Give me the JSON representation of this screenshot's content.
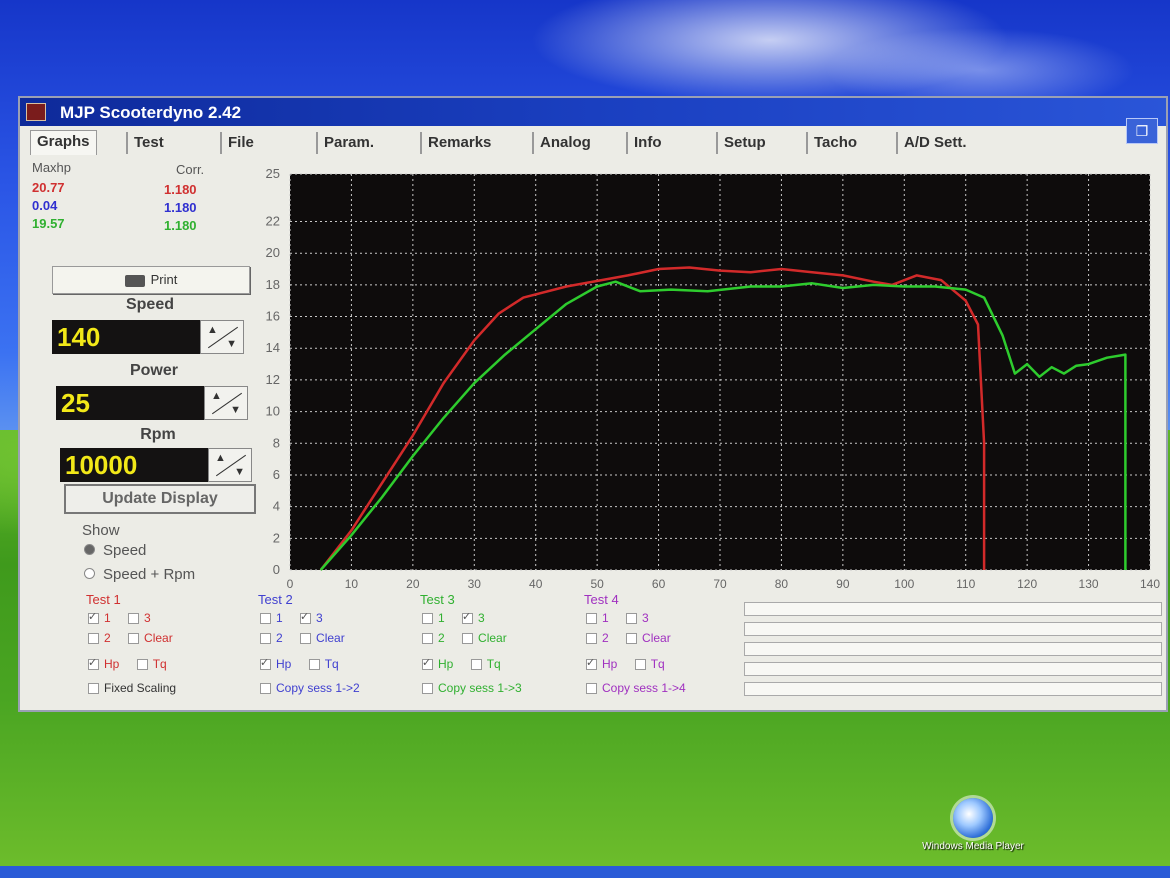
{
  "window": {
    "title": "MJP Scooterdyno 2.42",
    "restore_glyph": "❐"
  },
  "tabs": [
    "Graphs",
    "Test",
    "File",
    "Param.",
    "Remarks",
    "Analog",
    "Info",
    "Setup",
    "Tacho",
    "A/D Sett."
  ],
  "legend": {
    "col1_header": "Maxhp",
    "col2_header": "Corr.",
    "rows": [
      {
        "maxhp": "20.77",
        "corr": "1.180",
        "color": "#d03030"
      },
      {
        "maxhp": "0.04",
        "corr": "1.180",
        "color": "#3030d0"
      },
      {
        "maxhp": "19.57",
        "corr": "1.180",
        "color": "#30b030"
      }
    ]
  },
  "print_button": "Print",
  "speed": {
    "label": "Speed",
    "value": "140"
  },
  "power": {
    "label": "Power",
    "value": "25"
  },
  "rpm": {
    "label": "Rpm",
    "value": "10000"
  },
  "update_button": "Update Display",
  "show": {
    "title": "Show",
    "options": [
      "Speed",
      "Speed + Rpm"
    ],
    "selected": "Speed"
  },
  "tests": [
    {
      "title": "Test 1",
      "color": "#d03030",
      "opt1": "1",
      "opt2": "2",
      "opt3": "3",
      "clear": "Clear",
      "hp": "Hp",
      "tq": "Tq",
      "footer": "Fixed Scaling"
    },
    {
      "title": "Test 2",
      "color": "#4040d0",
      "opt1": "1",
      "opt2": "2",
      "opt3": "3",
      "clear": "Clear",
      "hp": "Hp",
      "tq": "Tq",
      "footer": "Copy sess 1->2"
    },
    {
      "title": "Test 3",
      "color": "#30b030",
      "opt1": "1",
      "opt2": "2",
      "opt3": "3",
      "clear": "Clear",
      "hp": "Hp",
      "tq": "Tq",
      "footer": "Copy sess 1->3"
    },
    {
      "title": "Test 4",
      "color": "#a030c0",
      "opt1": "1",
      "opt2": "2",
      "opt3": "3",
      "clear": "Clear",
      "hp": "Hp",
      "tq": "Tq",
      "footer": "Copy sess 1->4"
    }
  ],
  "desktop_icon": {
    "label": "Windows Media Player",
    "name": "windows-media-player-icon"
  },
  "chart_data": {
    "type": "line",
    "background": "#0e0c0c",
    "grid": true,
    "xlim": [
      0,
      140
    ],
    "ylim": [
      0,
      25
    ],
    "x_ticks": [
      0,
      10,
      20,
      30,
      40,
      50,
      60,
      70,
      80,
      90,
      100,
      110,
      120,
      130,
      140
    ],
    "y_ticks": [
      0,
      2,
      4,
      6,
      8,
      10,
      12,
      14,
      16,
      18,
      20,
      22,
      25
    ],
    "series": [
      {
        "color": "#d22a2a",
        "points": [
          [
            5,
            0
          ],
          [
            10,
            2.5
          ],
          [
            15,
            5.5
          ],
          [
            20,
            8.5
          ],
          [
            25,
            11.8
          ],
          [
            30,
            14.5
          ],
          [
            34,
            16.2
          ],
          [
            38,
            17.2
          ],
          [
            45,
            17.9
          ],
          [
            55,
            18.6
          ],
          [
            60,
            19.0
          ],
          [
            65,
            19.1
          ],
          [
            70,
            18.9
          ],
          [
            75,
            18.8
          ],
          [
            80,
            19.0
          ],
          [
            85,
            18.8
          ],
          [
            90,
            18.6
          ],
          [
            95,
            18.2
          ],
          [
            98,
            18.0
          ],
          [
            102,
            18.6
          ],
          [
            106,
            18.3
          ],
          [
            110,
            17.0
          ],
          [
            112,
            15.5
          ],
          [
            113,
            8.0
          ],
          [
            113,
            0
          ]
        ]
      },
      {
        "color": "#2ecc2e",
        "points": [
          [
            5,
            0
          ],
          [
            10,
            2.2
          ],
          [
            15,
            4.6
          ],
          [
            20,
            7.2
          ],
          [
            25,
            9.6
          ],
          [
            30,
            11.8
          ],
          [
            35,
            13.6
          ],
          [
            40,
            15.2
          ],
          [
            45,
            16.8
          ],
          [
            50,
            17.9
          ],
          [
            53,
            18.2
          ],
          [
            57,
            17.6
          ],
          [
            62,
            17.7
          ],
          [
            68,
            17.6
          ],
          [
            75,
            17.9
          ],
          [
            80,
            17.9
          ],
          [
            85,
            18.1
          ],
          [
            90,
            17.8
          ],
          [
            95,
            18.0
          ],
          [
            100,
            17.9
          ],
          [
            105,
            17.9
          ],
          [
            110,
            17.7
          ],
          [
            113,
            17.2
          ],
          [
            116,
            14.8
          ],
          [
            118,
            12.4
          ],
          [
            120,
            13.0
          ],
          [
            122,
            12.2
          ],
          [
            124,
            12.8
          ],
          [
            126,
            12.4
          ],
          [
            128,
            12.9
          ],
          [
            130,
            13.0
          ],
          [
            133,
            13.4
          ],
          [
            136,
            13.6
          ],
          [
            136,
            0
          ]
        ]
      }
    ]
  }
}
